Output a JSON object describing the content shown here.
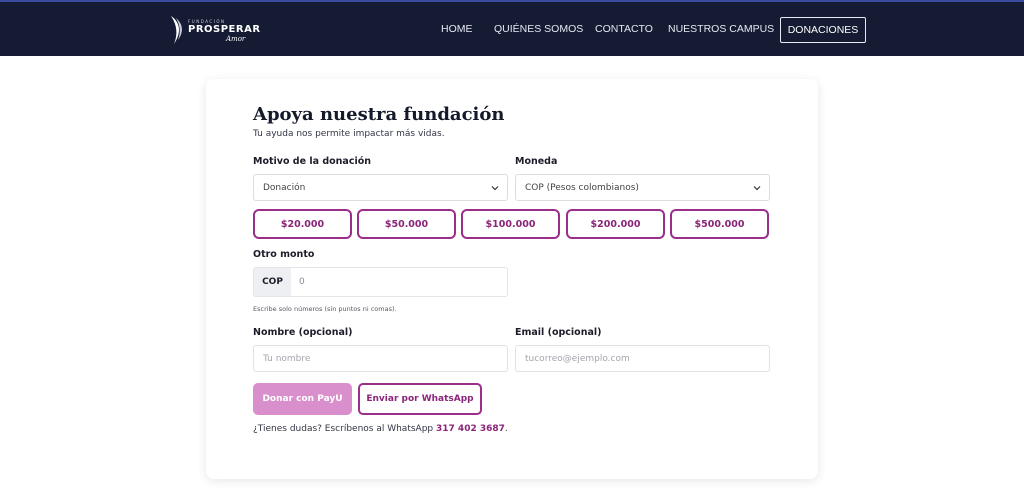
{
  "header": {
    "logo": {
      "small_text": "FUNDACIÓN",
      "main_text": "PROSPERAR",
      "script_text": "Amor"
    },
    "nav": [
      "HOME",
      "QUIÉNES SOMOS",
      "CONTACTO",
      "NUESTROS CAMPUS"
    ],
    "cta": "DONACIONES"
  },
  "form": {
    "title": "Apoya nuestra fundación",
    "subtitle": "Tu ayuda nos permite impactar más vidas.",
    "reason_label": "Motivo de la donación",
    "reason_value": "Donación",
    "currency_label": "Moneda",
    "currency_value": "COP (Pesos colombianos)",
    "amounts": [
      "$20.000",
      "$50.000",
      "$100.000",
      "$200.000",
      "$500.000"
    ],
    "other_amount_label": "Otro monto",
    "currency_tag": "COP",
    "other_amount_value": "0",
    "hint": "Escribe solo números (sin puntos ni comas).",
    "name_label": "Nombre (opcional)",
    "name_placeholder": "Tu nombre",
    "email_label": "Email (opcional)",
    "email_placeholder": "tucorreo@ejemplo.com",
    "pay_button": "Donar con PayU",
    "whatsapp_button": "Enviar por WhatsApp",
    "footer_prefix": "¿Tienes dudas? Escríbenos al WhatsApp",
    "footer_phone": "317 402 3687",
    "footer_suffix": "."
  },
  "colors": {
    "navbar": "#141b33",
    "accent": "#9b2e8a",
    "primary_disabled": "#d98fcb"
  }
}
